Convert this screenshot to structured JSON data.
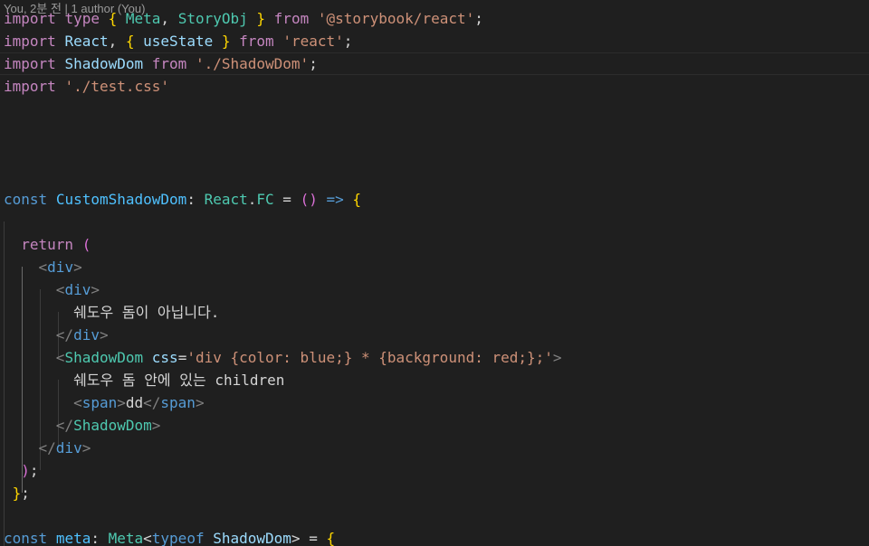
{
  "blame": {
    "text": "You, 2분 전 | 1 author (You)"
  },
  "editor": {
    "lines": [
      {
        "row": 0,
        "tokens": [
          {
            "t": "import",
            "c": "keyword-import"
          },
          {
            "t": " ",
            "c": "plain"
          },
          {
            "t": "type",
            "c": "keyword-import"
          },
          {
            "t": " ",
            "c": "plain"
          },
          {
            "t": "{",
            "c": "brace"
          },
          {
            "t": " ",
            "c": "plain"
          },
          {
            "t": "Meta",
            "c": "type"
          },
          {
            "t": ", ",
            "c": "punct"
          },
          {
            "t": "StoryObj",
            "c": "type"
          },
          {
            "t": " ",
            "c": "plain"
          },
          {
            "t": "}",
            "c": "brace"
          },
          {
            "t": " ",
            "c": "plain"
          },
          {
            "t": "from",
            "c": "keyword-import"
          },
          {
            "t": " ",
            "c": "plain"
          },
          {
            "t": "'@storybook/react'",
            "c": "string"
          },
          {
            "t": ";",
            "c": "punct"
          }
        ]
      },
      {
        "row": 1,
        "tokens": [
          {
            "t": "import",
            "c": "keyword-import"
          },
          {
            "t": " ",
            "c": "plain"
          },
          {
            "t": "React",
            "c": "var"
          },
          {
            "t": ", ",
            "c": "punct"
          },
          {
            "t": "{",
            "c": "brace"
          },
          {
            "t": " ",
            "c": "plain"
          },
          {
            "t": "useState",
            "c": "var"
          },
          {
            "t": " ",
            "c": "plain"
          },
          {
            "t": "}",
            "c": "brace"
          },
          {
            "t": " ",
            "c": "plain"
          },
          {
            "t": "from",
            "c": "keyword-import"
          },
          {
            "t": " ",
            "c": "plain"
          },
          {
            "t": "'react'",
            "c": "string"
          },
          {
            "t": ";",
            "c": "punct"
          }
        ]
      },
      {
        "row": 2,
        "current": true,
        "tokens": [
          {
            "t": "import",
            "c": "keyword-import"
          },
          {
            "t": " ",
            "c": "plain"
          },
          {
            "t": "ShadowDom",
            "c": "var"
          },
          {
            "t": " ",
            "c": "plain"
          },
          {
            "t": "from",
            "c": "keyword-import"
          },
          {
            "t": " ",
            "c": "plain"
          },
          {
            "t": "'./ShadowDom'",
            "c": "string"
          },
          {
            "t": ";",
            "c": "punct"
          }
        ]
      },
      {
        "row": 3,
        "tokens": [
          {
            "t": "import",
            "c": "keyword-import"
          },
          {
            "t": " ",
            "c": "plain"
          },
          {
            "t": "'./test.css'",
            "c": "string"
          }
        ]
      },
      {
        "row": 8,
        "tokens": [
          {
            "t": "const",
            "c": "keyword"
          },
          {
            "t": " ",
            "c": "plain"
          },
          {
            "t": "CustomShadowDom",
            "c": "const"
          },
          {
            "t": ": ",
            "c": "punct"
          },
          {
            "t": "React",
            "c": "type"
          },
          {
            "t": ".",
            "c": "punct"
          },
          {
            "t": "FC",
            "c": "type"
          },
          {
            "t": " = ",
            "c": "punct"
          },
          {
            "t": "()",
            "c": "brace2"
          },
          {
            "t": " ",
            "c": "plain"
          },
          {
            "t": "=>",
            "c": "keyword"
          },
          {
            "t": " ",
            "c": "plain"
          },
          {
            "t": "{",
            "c": "brace"
          }
        ]
      },
      {
        "row": 10,
        "tokens": [
          {
            "t": "  ",
            "c": "plain"
          },
          {
            "t": "return",
            "c": "keyword-ctl"
          },
          {
            "t": " ",
            "c": "plain"
          },
          {
            "t": "(",
            "c": "brace2"
          }
        ]
      },
      {
        "row": 11,
        "tokens": [
          {
            "t": "    ",
            "c": "plain"
          },
          {
            "t": "<",
            "c": "angle"
          },
          {
            "t": "div",
            "c": "tag"
          },
          {
            "t": ">",
            "c": "angle"
          }
        ]
      },
      {
        "row": 12,
        "tokens": [
          {
            "t": "      ",
            "c": "plain"
          },
          {
            "t": "<",
            "c": "angle"
          },
          {
            "t": "div",
            "c": "tag"
          },
          {
            "t": ">",
            "c": "angle"
          }
        ]
      },
      {
        "row": 13,
        "tokens": [
          {
            "t": "        ",
            "c": "plain"
          },
          {
            "t": "쉐도우 돔이 아닙니다.",
            "c": "plain"
          }
        ]
      },
      {
        "row": 14,
        "tokens": [
          {
            "t": "      ",
            "c": "plain"
          },
          {
            "t": "</",
            "c": "angle"
          },
          {
            "t": "div",
            "c": "tag"
          },
          {
            "t": ">",
            "c": "angle"
          }
        ]
      },
      {
        "row": 15,
        "tokens": [
          {
            "t": "      ",
            "c": "plain"
          },
          {
            "t": "<",
            "c": "angle"
          },
          {
            "t": "ShadowDom",
            "c": "comp"
          },
          {
            "t": " ",
            "c": "plain"
          },
          {
            "t": "css",
            "c": "attr"
          },
          {
            "t": "=",
            "c": "punct"
          },
          {
            "t": "'div {color: blue;} * {background: red;};'",
            "c": "string"
          },
          {
            "t": ">",
            "c": "angle"
          }
        ]
      },
      {
        "row": 16,
        "tokens": [
          {
            "t": "        ",
            "c": "plain"
          },
          {
            "t": "쉐도우 돔 안에 있는 children",
            "c": "plain"
          }
        ]
      },
      {
        "row": 17,
        "tokens": [
          {
            "t": "        ",
            "c": "plain"
          },
          {
            "t": "<",
            "c": "angle"
          },
          {
            "t": "span",
            "c": "tag"
          },
          {
            "t": ">",
            "c": "angle"
          },
          {
            "t": "dd",
            "c": "plain"
          },
          {
            "t": "</",
            "c": "angle"
          },
          {
            "t": "span",
            "c": "tag"
          },
          {
            "t": ">",
            "c": "angle"
          }
        ]
      },
      {
        "row": 18,
        "tokens": [
          {
            "t": "      ",
            "c": "plain"
          },
          {
            "t": "</",
            "c": "angle"
          },
          {
            "t": "ShadowDom",
            "c": "comp"
          },
          {
            "t": ">",
            "c": "angle"
          }
        ]
      },
      {
        "row": 19,
        "tokens": [
          {
            "t": "    ",
            "c": "plain"
          },
          {
            "t": "</",
            "c": "angle"
          },
          {
            "t": "div",
            "c": "tag"
          },
          {
            "t": ">",
            "c": "angle"
          }
        ]
      },
      {
        "row": 20,
        "tokens": [
          {
            "t": "  ",
            "c": "plain"
          },
          {
            "t": ")",
            "c": "brace2"
          },
          {
            "t": ";",
            "c": "punct"
          }
        ]
      },
      {
        "row": 21,
        "tokens": [
          {
            "t": " ",
            "c": "plain"
          },
          {
            "t": "}",
            "c": "brace"
          },
          {
            "t": ";",
            "c": "punct"
          }
        ]
      },
      {
        "row": 23,
        "tokens": [
          {
            "t": "const",
            "c": "keyword"
          },
          {
            "t": " ",
            "c": "plain"
          },
          {
            "t": "meta",
            "c": "const"
          },
          {
            "t": ": ",
            "c": "punct"
          },
          {
            "t": "Meta",
            "c": "type"
          },
          {
            "t": "<",
            "c": "punct"
          },
          {
            "t": "typeof",
            "c": "keyword"
          },
          {
            "t": " ",
            "c": "plain"
          },
          {
            "t": "ShadowDom",
            "c": "var"
          },
          {
            "t": "> = ",
            "c": "punct"
          },
          {
            "t": "{",
            "c": "brace"
          }
        ]
      }
    ]
  }
}
